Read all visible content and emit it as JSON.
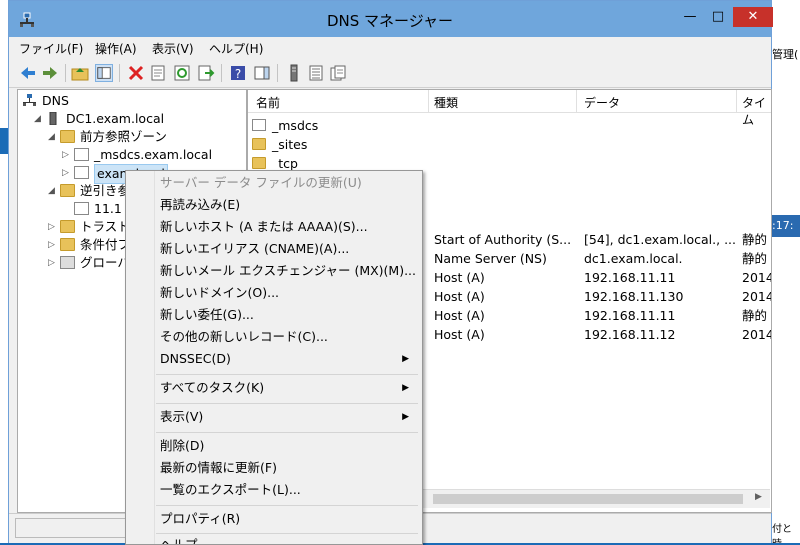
{
  "window": {
    "title": "DNS マネージャー",
    "min": "—",
    "max": "□",
    "close": "✕"
  },
  "menu": [
    "ファイル(F)",
    "操作(A)",
    "表示(V)",
    "ヘルプ(H)"
  ],
  "tree": {
    "root": "DNS",
    "server": "DC1.exam.local",
    "forward": "前方参照ゾーン",
    "msdcs_zone": "_msdcs.exam.local",
    "exam_zone": "exam.local",
    "reverse": "逆引き参",
    "reverse_child": "11.1",
    "trust": "トラスト ポ",
    "conditional": "条件付フ",
    "global": "グローバル"
  },
  "list": {
    "headers": [
      "名前",
      "種類",
      "データ",
      "タイム"
    ],
    "rows": [
      {
        "name": "_msdcs",
        "type": "",
        "data": "",
        "time": ""
      },
      {
        "name": "_sites",
        "type": "",
        "data": "",
        "time": ""
      },
      {
        "name": "_tcp",
        "type": "",
        "data": "",
        "time": ""
      },
      {
        "name": "",
        "type": "Start of Authority (S...",
        "data": "[54], dc1.exam.local., ...",
        "time": "静的"
      },
      {
        "name": "",
        "type": "Name Server (NS)",
        "data": "dc1.exam.local.",
        "time": "静的"
      },
      {
        "name": "",
        "type": "Host (A)",
        "data": "192.168.11.11",
        "time": "2014"
      },
      {
        "name": "",
        "type": "Host (A)",
        "data": "192.168.11.130",
        "time": "2014"
      },
      {
        "name": "",
        "type": "Host (A)",
        "data": "192.168.11.11",
        "time": "静的"
      },
      {
        "name": "",
        "type": "Host (A)",
        "data": "192.168.11.12",
        "time": "2014"
      }
    ]
  },
  "context_menu": {
    "update": "サーバー データ ファイルの更新(U)",
    "reload": "再読み込み(E)",
    "new_host": "新しいホスト (A または AAAA)(S)...",
    "new_alias": "新しいエイリアス (CNAME)(A)...",
    "new_mx": "新しいメール エクスチェンジャー (MX)(M)...",
    "new_domain": "新しいドメイン(O)...",
    "new_delegation": "新しい委任(G)...",
    "other_records": "その他の新しいレコード(C)...",
    "dnssec": "DNSSEC(D)",
    "all_tasks": "すべてのタスク(K)",
    "view": "表示(V)",
    "delete": "削除(D)",
    "refresh": "最新の情報に更新(F)",
    "export": "一覧のエクスポート(L)...",
    "properties": "プロパティ(R)",
    "help": "ヘルプ"
  },
  "background": {
    "right_top": "管理(",
    "right_mid": ":17:",
    "right_bottom": "付と時"
  }
}
